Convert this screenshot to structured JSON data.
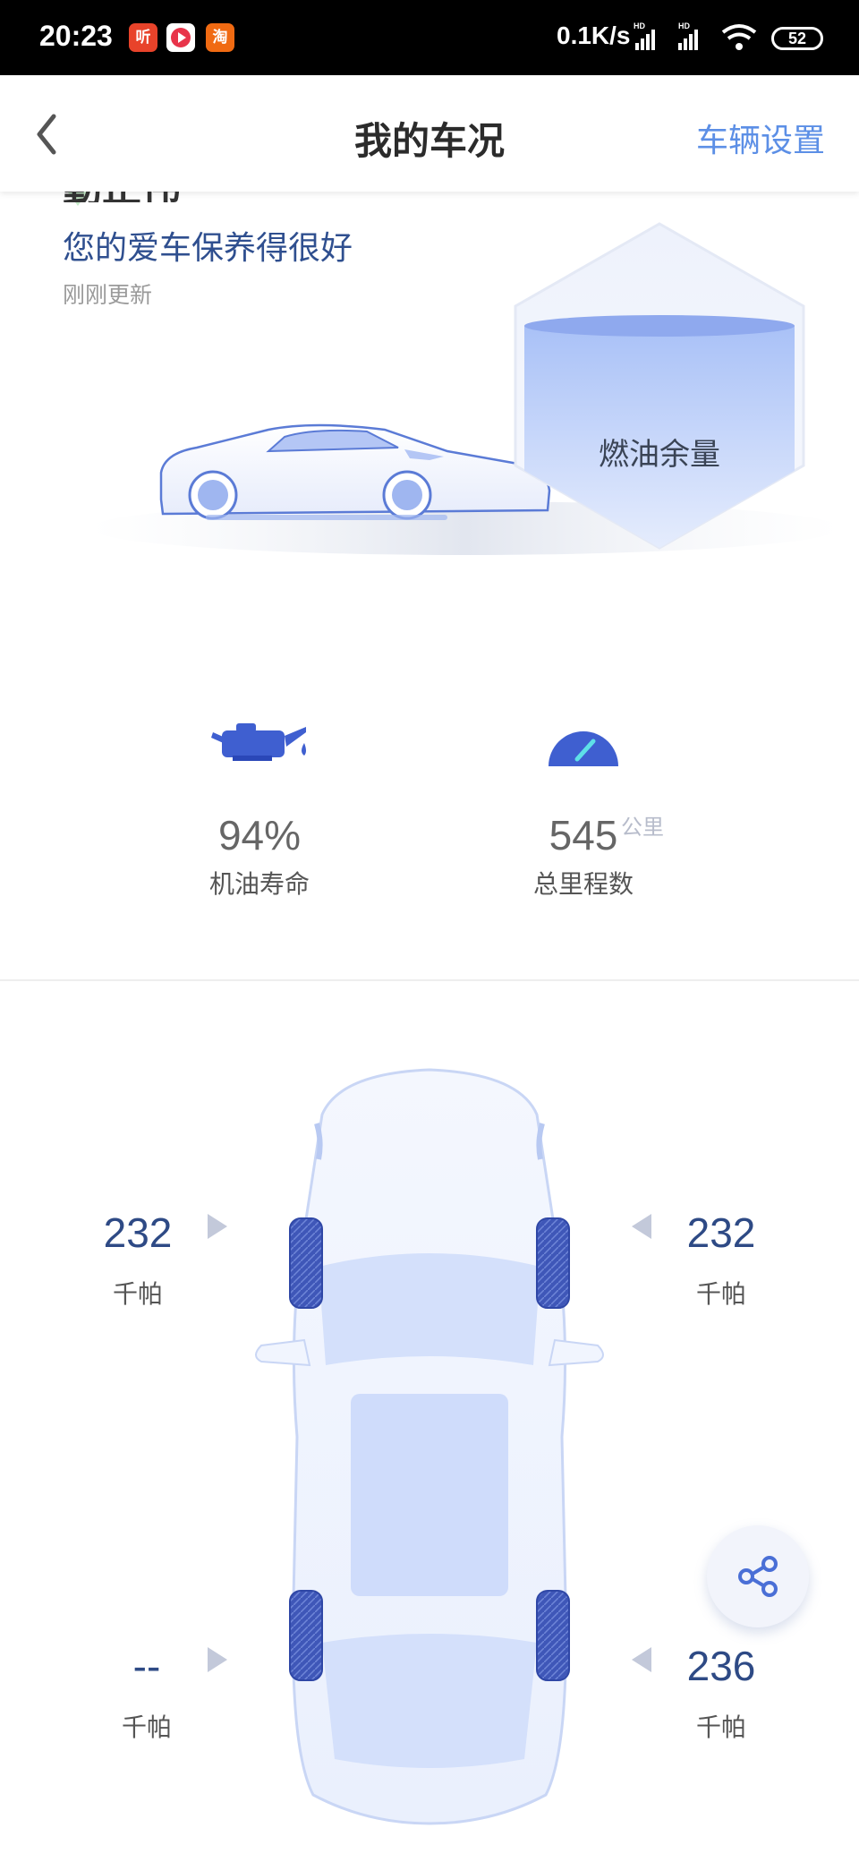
{
  "status_bar": {
    "time": "20:23",
    "app_icons": [
      {
        "icon": "ting-app-icon",
        "text": "听",
        "color": "#e8432a"
      },
      {
        "icon": "video-app-icon",
        "text": "",
        "color": "#e8344a"
      },
      {
        "icon": "taobao-app-icon",
        "text": "淘",
        "color": "#f06a12"
      }
    ],
    "net_speed": "0.1K/s",
    "battery": "52"
  },
  "nav": {
    "back_icon": "chevron-left-icon",
    "title": "我的车况",
    "right_action": "车辆设置"
  },
  "health": {
    "title_partial": "動止伟",
    "subtitle": "您的爱车保养得很好",
    "updated": "刚刚更新"
  },
  "fuel": {
    "label": "燃油余量"
  },
  "stats": [
    {
      "icon": "oil-can-icon",
      "value": "94%",
      "label": "机油寿命"
    },
    {
      "icon": "speedometer-icon",
      "value": "545",
      "unit": "公里",
      "label": "总里程数"
    }
  ],
  "tires": {
    "front_left": {
      "value": "232",
      "unit": "千帕"
    },
    "front_right": {
      "value": "232",
      "unit": "千帕"
    },
    "rear_left": {
      "value": "--",
      "unit": "千帕"
    },
    "rear_right": {
      "value": "236",
      "unit": "千帕"
    }
  },
  "share": {
    "icon": "share-icon"
  },
  "colors": {
    "accent": "#5c8fe6",
    "tire_blue": "#3f57b8",
    "text_dark": "#2e4a85"
  }
}
